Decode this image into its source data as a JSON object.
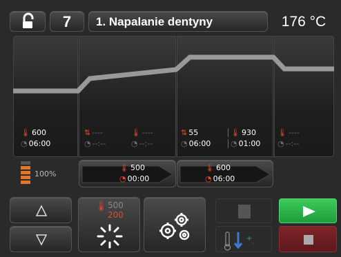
{
  "header": {
    "program_number": "7",
    "program_title": "1. Napalanie dentyny",
    "temperature": "176 °C"
  },
  "stages": [
    {
      "id": "s1",
      "temp": "600",
      "time": "06:00"
    },
    {
      "id": "s2",
      "rate": "----",
      "time": "--:--",
      "temp": "----",
      "time2": "--:--"
    },
    {
      "id": "s3",
      "rate": "55",
      "time": "06:00",
      "temp": "930",
      "time2": "01:00"
    },
    {
      "id": "s4",
      "temp": "----",
      "time": "--:--"
    }
  ],
  "power": {
    "label": "100%"
  },
  "presets": [
    {
      "temp": "500",
      "time": "00:00"
    },
    {
      "temp": "600",
      "time": "06:00"
    }
  ],
  "controls": {
    "temp_setpoint_top": "500",
    "temp_setpoint_bottom": "200"
  },
  "colors": {
    "accent_red": "#e24a2a",
    "start_green": "#2bb24a",
    "stop_red": "#7a2226"
  }
}
